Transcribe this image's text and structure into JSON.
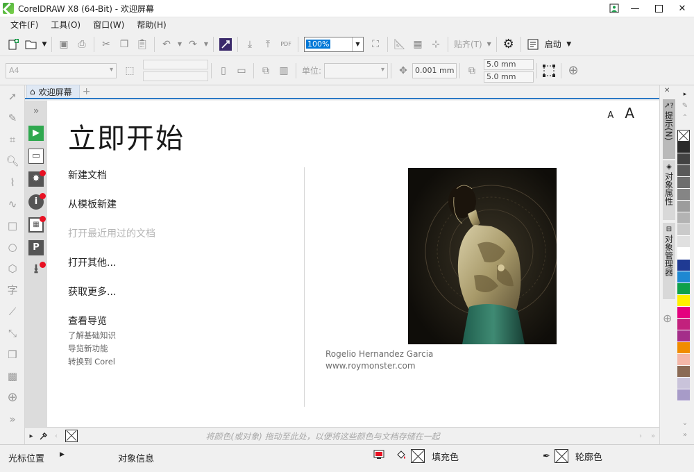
{
  "window": {
    "title": "CorelDRAW X8 (64-Bit) - 欢迎屏幕",
    "icon": "coreldraw-logo-icon"
  },
  "menu": [
    "文件(F)",
    "工具(O)",
    "窗口(W)",
    "帮助(H)"
  ],
  "toolbar": {
    "zoom_value": "100%",
    "snap_label": "贴齐(T)",
    "launch_label": "启动",
    "pdf_label": "PDF"
  },
  "property_bar": {
    "page_size": "A4",
    "units_label": "单位:",
    "nudge_value": "0.001 mm",
    "dup_x": "5.0 mm",
    "dup_y": "5.0 mm"
  },
  "tabs": [
    {
      "label": "欢迎屏幕",
      "icon": "home-icon",
      "active": true
    }
  ],
  "welcome": {
    "font_small": "A",
    "font_large": "A",
    "heading": "立即开始",
    "links": [
      {
        "label": "新建文档",
        "enabled": true
      },
      {
        "label": "从模板新建",
        "enabled": true
      },
      {
        "label": "打开最近用过的文档",
        "enabled": false
      },
      {
        "label": "打开其他...",
        "enabled": true
      },
      {
        "label": "获取更多...",
        "enabled": true
      },
      {
        "label": "查看导览",
        "enabled": true
      }
    ],
    "sublinks": [
      "了解基础知识",
      "导览新功能",
      "转换到 Corel"
    ],
    "credit_name": "Rogelio Hernandez Garcia",
    "credit_url": "www.roymonster.com"
  },
  "color_tray": {
    "hint": "将颜色(或对象) 拖动至此处，以便将这些颜色与文档存储在一起"
  },
  "dockers": [
    {
      "label": "提示(N)",
      "icon": "hint-icon",
      "active": true
    },
    {
      "label": "对象属性",
      "icon": "object-properties-icon",
      "active": false
    },
    {
      "label": "对象管理器",
      "icon": "object-manager-icon",
      "active": false
    }
  ],
  "palette": [
    "#2b2b2b",
    "#424242",
    "#595959",
    "#6e6e6e",
    "#858585",
    "#9c9c9c",
    "#b3b3b3",
    "#cacaca",
    "#e0e0e0",
    "#ffffff",
    "#1f3a93",
    "#1e88d2",
    "#0ea04a",
    "#ffef00",
    "#e4007f",
    "#c2217d",
    "#a42e8a",
    "#f08c00",
    "#f4b7a8",
    "#8a6a55",
    "#c9c3da",
    "#a79bc8"
  ],
  "status": {
    "cursor_position": "光标位置",
    "object_info": "对象信息",
    "fill_label": "填充色",
    "outline_label": "轮廓色"
  }
}
